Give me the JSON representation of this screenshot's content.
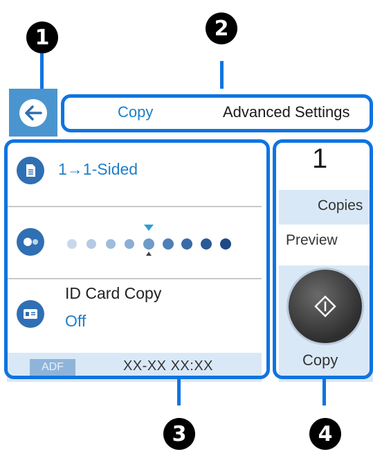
{
  "callouts": {
    "c1": "1",
    "c2": "2",
    "c3": "3",
    "c4": "4"
  },
  "topbar": {
    "back_icon": "arrow-left-icon",
    "tabs": [
      {
        "label": "Copy"
      },
      {
        "label": "Advanced Settings"
      }
    ]
  },
  "settings": {
    "sides": {
      "icon": "document-icon",
      "value": "1→1-Sided"
    },
    "density": {
      "icon": "density-icon",
      "dots": 9,
      "selected_index": 4
    },
    "id_card": {
      "icon": "id-card-icon",
      "label": "ID Card Copy",
      "value": "Off"
    },
    "footer": {
      "adf_label": "ADF",
      "datetime": "XX-XX XX:XX"
    }
  },
  "right_panel": {
    "copies_count": "1",
    "copies_label": "Copies",
    "preview_label": "Preview",
    "start_icon": "start-diamond-icon",
    "start_label": "Copy"
  },
  "colors": {
    "highlight": "#0f74df",
    "accent_blue": "#1f7fc7",
    "panel_blue": "#d9e8f6",
    "icon_blue": "#2f6fb3"
  }
}
